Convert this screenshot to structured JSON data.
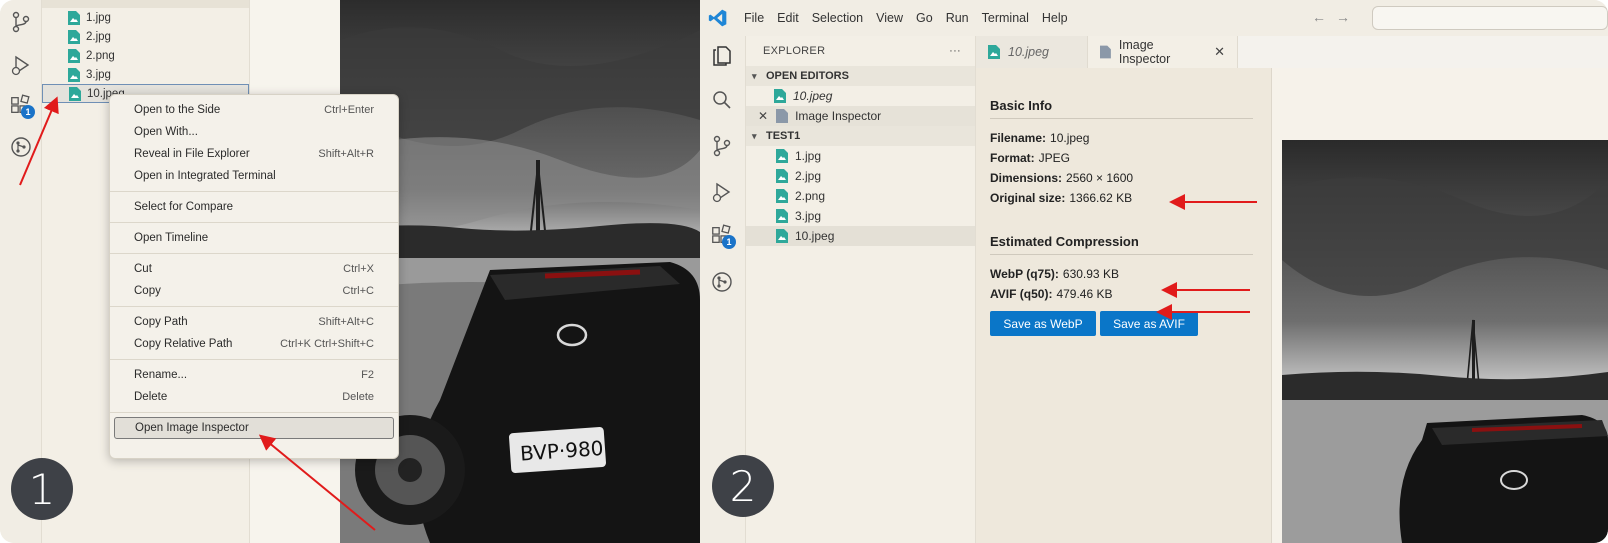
{
  "colors": {
    "accent": "#0a76c8",
    "arrow": "#e11b1b",
    "badge": "#1a73c8",
    "file_icon": "#2ea89a"
  },
  "panel1": {
    "files": [
      {
        "name": "1.jpg"
      },
      {
        "name": "2.jpg"
      },
      {
        "name": "2.png"
      },
      {
        "name": "3.jpg"
      },
      {
        "name": "10.jpeg"
      }
    ],
    "extensions_badge": "1",
    "context_menu": {
      "groups": [
        [
          {
            "label": "Open to the Side",
            "shortcut": "Ctrl+Enter"
          },
          {
            "label": "Open With...",
            "shortcut": ""
          },
          {
            "label": "Reveal in File Explorer",
            "shortcut": "Shift+Alt+R"
          },
          {
            "label": "Open in Integrated Terminal",
            "shortcut": ""
          }
        ],
        [
          {
            "label": "Select for Compare",
            "shortcut": ""
          }
        ],
        [
          {
            "label": "Open Timeline",
            "shortcut": ""
          }
        ],
        [
          {
            "label": "Cut",
            "shortcut": "Ctrl+X"
          },
          {
            "label": "Copy",
            "shortcut": "Ctrl+C"
          }
        ],
        [
          {
            "label": "Copy Path",
            "shortcut": "Shift+Alt+C"
          },
          {
            "label": "Copy Relative Path",
            "shortcut": "Ctrl+K Ctrl+Shift+C"
          }
        ],
        [
          {
            "label": "Rename...",
            "shortcut": "F2"
          },
          {
            "label": "Delete",
            "shortcut": "Delete"
          }
        ],
        [
          {
            "label": "Open Image Inspector",
            "shortcut": ""
          }
        ]
      ]
    },
    "step_label": "1"
  },
  "panel2": {
    "menu": [
      "File",
      "Edit",
      "Selection",
      "View",
      "Go",
      "Run",
      "Terminal",
      "Help"
    ],
    "explorer_title": "EXPLORER",
    "explorer_more": "···",
    "open_editors_label": "OPEN EDITORS",
    "open_editors": [
      {
        "name": "10.jpeg"
      },
      {
        "name": "Image Inspector"
      }
    ],
    "project_label": "TEST1",
    "project_files": [
      {
        "name": "1.jpg"
      },
      {
        "name": "2.jpg"
      },
      {
        "name": "2.png"
      },
      {
        "name": "3.jpg"
      },
      {
        "name": "10.jpeg"
      }
    ],
    "extensions_badge": "1",
    "tabs": [
      {
        "label": "10.jpeg"
      },
      {
        "label": "Image Inspector"
      }
    ],
    "inspector": {
      "basic_title": "Basic Info",
      "filename_label": "Filename:",
      "filename": "10.jpeg",
      "format_label": "Format:",
      "format": "JPEG",
      "dimensions_label": "Dimensions:",
      "dimensions": "2560 × 1600",
      "size_label": "Original size:",
      "size": "1366.62 KB",
      "compression_title": "Estimated Compression",
      "webp_label": "WebP (q75):",
      "webp": "630.93 KB",
      "avif_label": "AVIF (q50):",
      "avif": "479.46 KB",
      "save_webp": "Save as WebP",
      "save_avif": "Save as AVIF"
    },
    "step_label": "2"
  }
}
